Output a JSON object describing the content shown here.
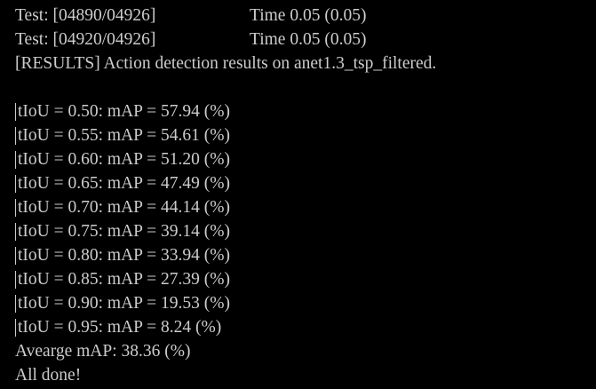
{
  "window": {
    "background": "#000000",
    "text_color": "#cccccc"
  },
  "progress_lines": [
    {
      "label": "Test: [04890/04926]",
      "time": "Time 0.05 (0.05)"
    },
    {
      "label": "Test: [04920/04926]",
      "time": "Time 0.05 (0.05)"
    }
  ],
  "results_header": "[RESULTS] Action detection results on anet1.3_tsp_filtered.",
  "results": [
    "tIoU = 0.50: mAP = 57.94 (%)",
    "tIoU = 0.55: mAP = 54.61 (%)",
    "tIoU = 0.60: mAP = 51.20 (%)",
    "tIoU = 0.65: mAP = 47.49 (%)",
    "tIoU = 0.70: mAP = 44.14 (%)",
    "tIoU = 0.75: mAP = 39.14 (%)",
    "tIoU = 0.80: mAP = 33.94 (%)",
    "tIoU = 0.85: mAP = 27.39 (%)",
    "tIoU = 0.90: mAP = 19.53 (%)",
    "tIoU = 0.95: mAP = 8.24 (%)"
  ],
  "average_line": "Avearge mAP: 38.36 (%)",
  "done_line": "All done!"
}
